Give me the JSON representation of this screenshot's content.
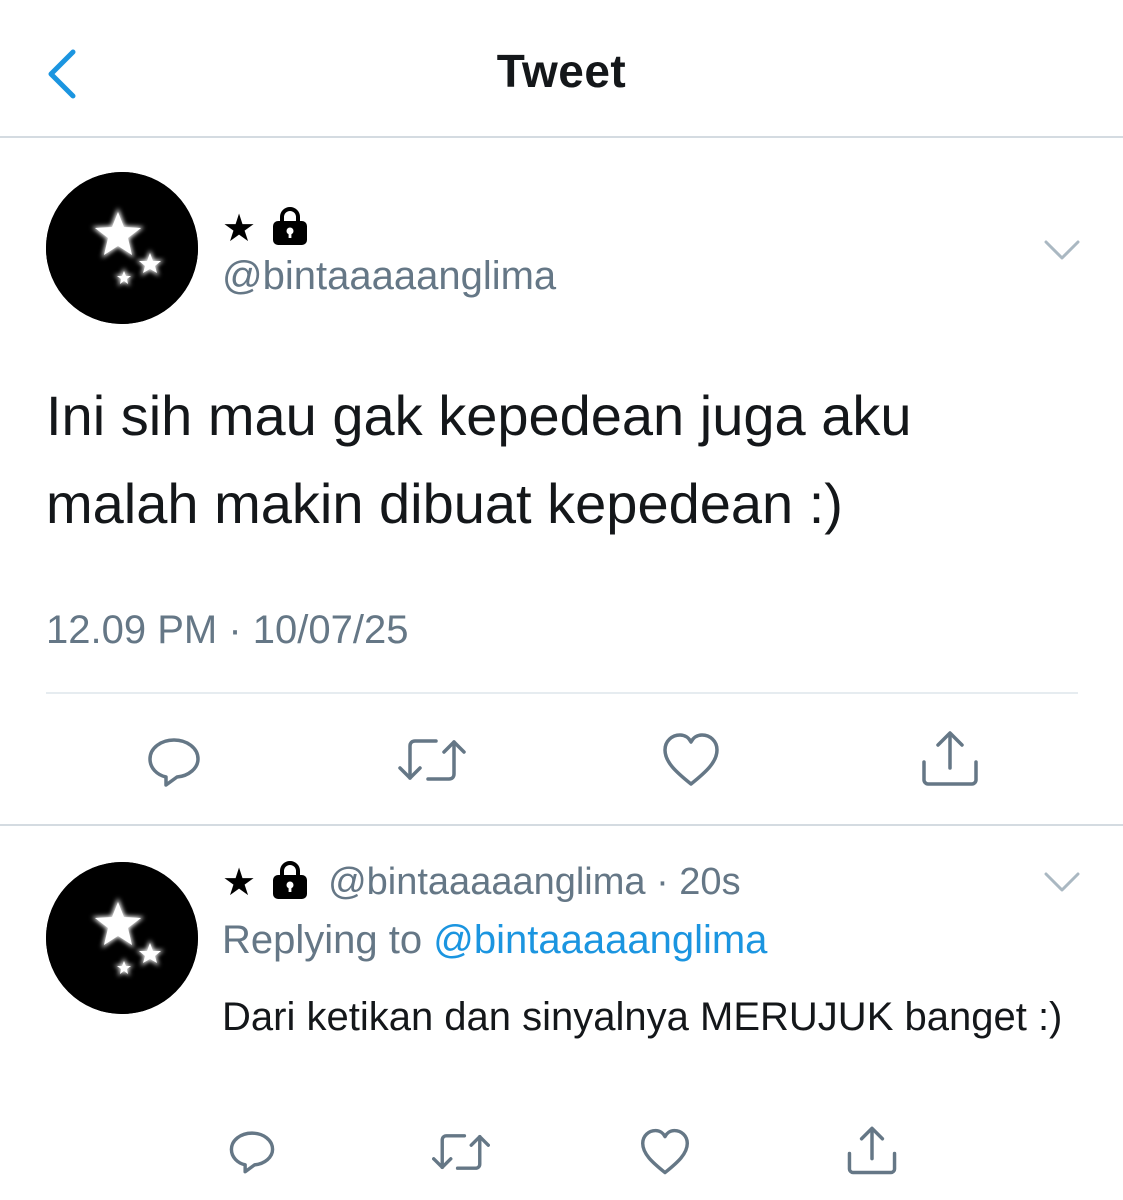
{
  "header": {
    "title": "Tweet",
    "back_icon": "chevron-left-icon"
  },
  "colors": {
    "accent": "#1b95e0",
    "secondary_text": "#657786",
    "divider": "#d4dbe1"
  },
  "tweet": {
    "name_star": "★",
    "handle": "@bintaaaaanglima",
    "text": "Ini sih mau gak kepedean juga aku malah makin dibuat kepedean :)",
    "timestamp": "12.09 PM · 10/07/25",
    "actions": [
      "reply-icon",
      "retweet-icon",
      "like-icon",
      "share-icon"
    ]
  },
  "reply": {
    "name_star": "★",
    "handle_meta": "@bintaaaaanglima · 20s",
    "replying_prefix": "Replying to",
    "replying_to": "@bintaaaaanglima",
    "text": "Dari ketikan dan sinyalnya MERUJUK banget :)",
    "actions": [
      "reply-icon",
      "retweet-icon",
      "like-icon",
      "share-icon"
    ]
  }
}
